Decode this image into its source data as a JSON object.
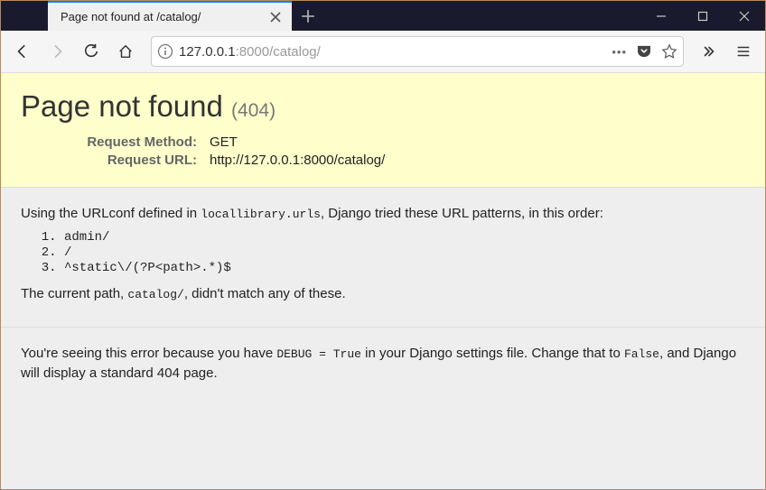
{
  "window": {
    "tab_title": "Page not found at /catalog/"
  },
  "urlbar": {
    "display_host": "127.0.0.1",
    "display_rest": ":8000/catalog/",
    "dots": "•••"
  },
  "error": {
    "title": "Page not found",
    "code": "(404)",
    "method_label": "Request Method:",
    "method_value": "GET",
    "url_label": "Request URL:",
    "url_value": "http://127.0.0.1:8000/catalog/"
  },
  "body": {
    "intro_pre": "Using the URLconf defined in ",
    "intro_code": "locallibrary.urls",
    "intro_post": ", Django tried these URL patterns, in this order:",
    "patterns": [
      "admin/",
      "/",
      "^static\\/(?P<path>.*)$"
    ],
    "nomatch_pre": "The current path, ",
    "nomatch_code": "catalog/",
    "nomatch_post": ", didn't match any of these."
  },
  "footer": {
    "part1": "You're seeing this error because you have ",
    "code1": "DEBUG = True",
    "part2": " in your Django settings file. Change that to ",
    "code2": "False",
    "part3": ", and Django will display a standard 404 page."
  }
}
